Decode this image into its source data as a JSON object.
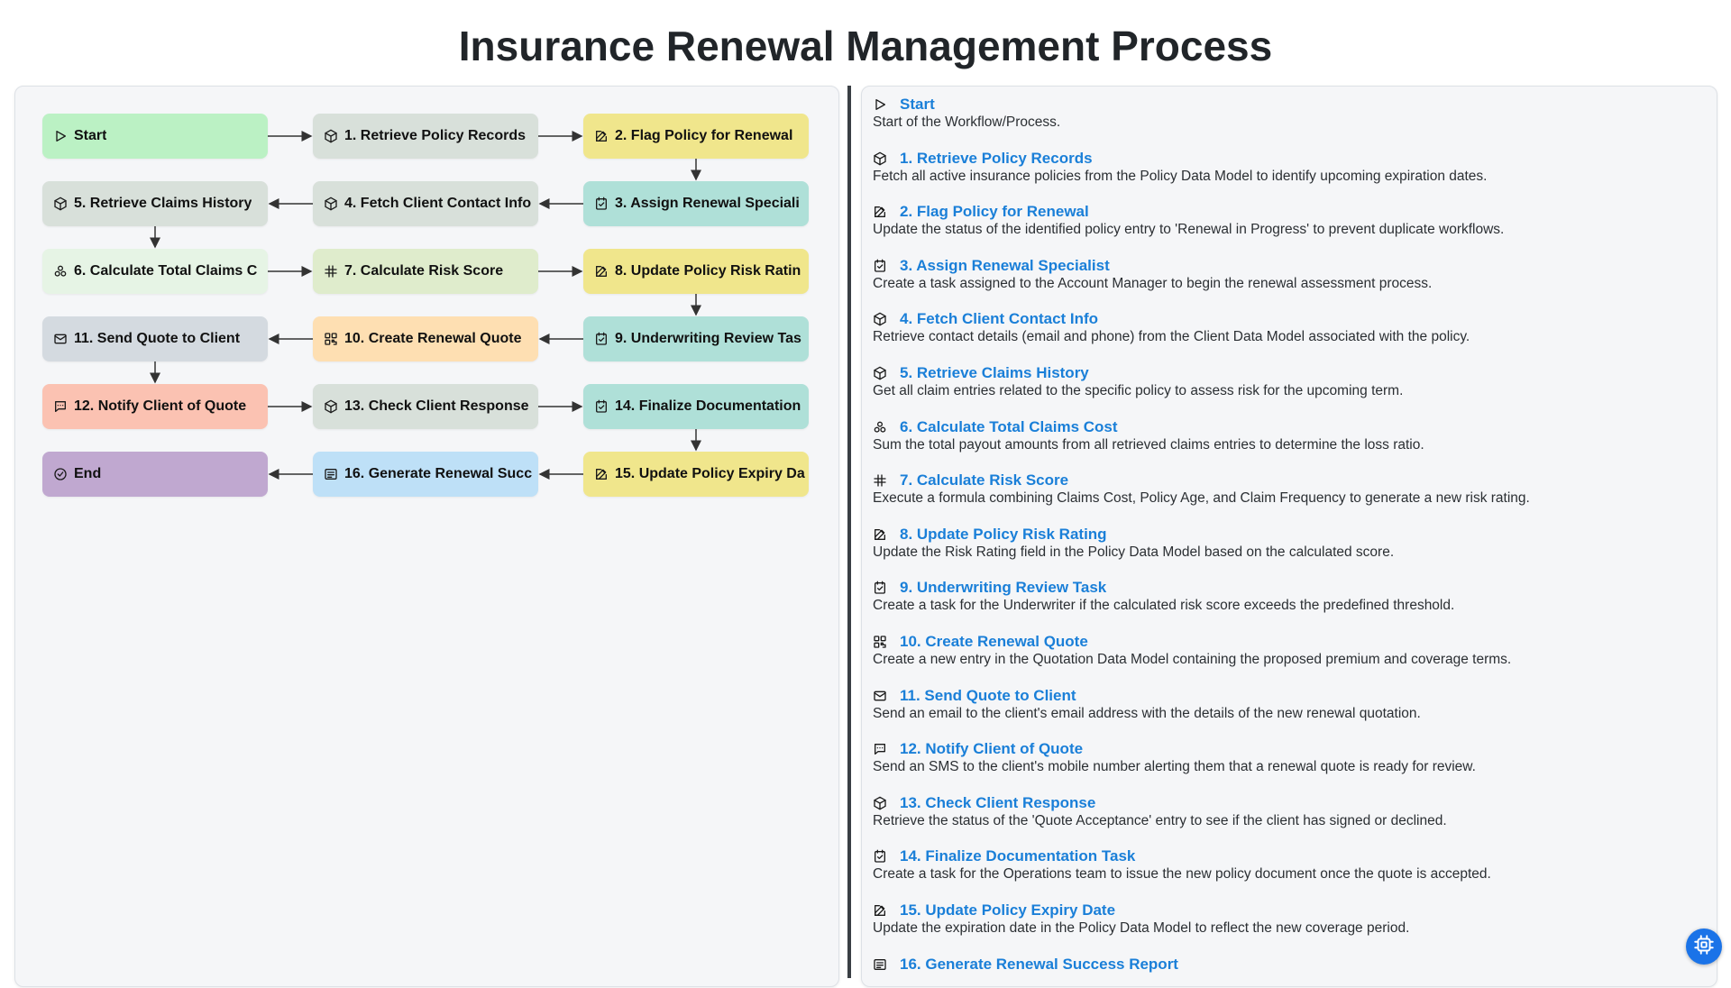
{
  "page": {
    "title": "Insurance Renewal Management Process"
  },
  "colors": {
    "start": "#bbf1c4",
    "records": "#d8e0da",
    "flag": "#f0e68c",
    "assign": "#afe0d8",
    "claims_history": "#d8e0da",
    "contact": "#d8e0da",
    "total_cost": "#e6f4e5",
    "risk": "#dfeccc",
    "update_rating": "#f0e68c",
    "send_quote": "#d4dae0",
    "renewal_quote": "#fedfb2",
    "underwriting": "#afe0d8",
    "notify": "#fbc2b2",
    "response": "#d8e0da",
    "finalize": "#afe0d8",
    "end": "#c0a8d0",
    "report": "#bee0f7",
    "expiry": "#f0e68c",
    "link": "#1a7fd8"
  },
  "flow": {
    "nodes": [
      {
        "id": "start",
        "label": "Start",
        "icon": "play-icon",
        "color": "#bbf1c4"
      },
      {
        "id": "n1",
        "label": "1. Retrieve Policy Records",
        "icon": "cube-icon",
        "color": "#d8e0da"
      },
      {
        "id": "n2",
        "label": "2. Flag Policy for Renewal",
        "icon": "edit-icon",
        "color": "#f0e68c"
      },
      {
        "id": "n3",
        "label": "3. Assign Renewal Speciali",
        "icon": "task-icon",
        "color": "#afe0d8"
      },
      {
        "id": "n4",
        "label": "4. Fetch Client Contact Info",
        "icon": "cube-icon",
        "color": "#d8e0da"
      },
      {
        "id": "n5",
        "label": "5. Retrieve Claims History",
        "icon": "cube-icon",
        "color": "#d8e0da"
      },
      {
        "id": "n6",
        "label": "6. Calculate Total Claims C",
        "icon": "aggregate-icon",
        "color": "#e6f4e5"
      },
      {
        "id": "n7",
        "label": "7. Calculate Risk Score",
        "icon": "formula-icon",
        "color": "#dfeccc"
      },
      {
        "id": "n8",
        "label": "8. Update Policy Risk Ratin",
        "icon": "edit-icon",
        "color": "#f0e68c"
      },
      {
        "id": "n9",
        "label": "9. Underwriting Review Tas",
        "icon": "task-icon",
        "color": "#afe0d8"
      },
      {
        "id": "n10",
        "label": "10. Create Renewal Quote",
        "icon": "grid-icon",
        "color": "#fedfb2"
      },
      {
        "id": "n11",
        "label": "11. Send Quote to Client",
        "icon": "mail-icon",
        "color": "#d4dae0"
      },
      {
        "id": "n12",
        "label": "12. Notify Client of Quote",
        "icon": "message-icon",
        "color": "#fbc2b2"
      },
      {
        "id": "n13",
        "label": "13. Check Client Response",
        "icon": "cube-icon",
        "color": "#d8e0da"
      },
      {
        "id": "n14",
        "label": "14. Finalize Documentation",
        "icon": "task-icon",
        "color": "#afe0d8"
      },
      {
        "id": "n15",
        "label": "15. Update Policy Expiry Da",
        "icon": "edit-icon",
        "color": "#f0e68c"
      },
      {
        "id": "n16",
        "label": "16. Generate Renewal Succ",
        "icon": "report-icon",
        "color": "#bee0f7"
      },
      {
        "id": "end",
        "label": "End",
        "icon": "check-circle-icon",
        "color": "#c0a8d0"
      }
    ]
  },
  "steps": [
    {
      "title": "Start",
      "icon": "play-icon",
      "desc": "Start of the Workflow/Process."
    },
    {
      "title": "1. Retrieve Policy Records",
      "icon": "cube-icon",
      "desc": "Fetch all active insurance policies from the Policy Data Model to identify upcoming expiration dates."
    },
    {
      "title": "2. Flag Policy for Renewal",
      "icon": "edit-icon",
      "desc": "Update the status of the identified policy entry to 'Renewal in Progress' to prevent duplicate workflows."
    },
    {
      "title": "3. Assign Renewal Specialist",
      "icon": "task-icon",
      "desc": "Create a task assigned to the Account Manager to begin the renewal assessment process."
    },
    {
      "title": "4. Fetch Client Contact Info",
      "icon": "cube-icon",
      "desc": "Retrieve contact details (email and phone) from the Client Data Model associated with the policy."
    },
    {
      "title": "5. Retrieve Claims History",
      "icon": "cube-icon",
      "desc": "Get all claim entries related to the specific policy to assess risk for the upcoming term."
    },
    {
      "title": "6. Calculate Total Claims Cost",
      "icon": "aggregate-icon",
      "desc": "Sum the total payout amounts from all retrieved claims entries to determine the loss ratio."
    },
    {
      "title": "7. Calculate Risk Score",
      "icon": "formula-icon",
      "desc": "Execute a formula combining Claims Cost, Policy Age, and Claim Frequency to generate a new risk rating."
    },
    {
      "title": "8. Update Policy Risk Rating",
      "icon": "edit-icon",
      "desc": "Update the Risk Rating field in the Policy Data Model based on the calculated score."
    },
    {
      "title": "9. Underwriting Review Task",
      "icon": "task-icon",
      "desc": "Create a task for the Underwriter if the calculated risk score exceeds the predefined threshold."
    },
    {
      "title": "10. Create Renewal Quote",
      "icon": "grid-icon",
      "desc": "Create a new entry in the Quotation Data Model containing the proposed premium and coverage terms."
    },
    {
      "title": "11. Send Quote to Client",
      "icon": "mail-icon",
      "desc": "Send an email to the client's email address with the details of the new renewal quotation."
    },
    {
      "title": "12. Notify Client of Quote",
      "icon": "message-icon",
      "desc": "Send an SMS to the client's mobile number alerting them that a renewal quote is ready for review."
    },
    {
      "title": "13. Check Client Response",
      "icon": "cube-icon",
      "desc": "Retrieve the status of the 'Quote Acceptance' entry to see if the client has signed or declined."
    },
    {
      "title": "14. Finalize Documentation Task",
      "icon": "task-icon",
      "desc": "Create a task for the Operations team to issue the new policy document once the quote is accepted."
    },
    {
      "title": "15. Update Policy Expiry Date",
      "icon": "edit-icon",
      "desc": "Update the expiration date in the Policy Data Model to reflect the new coverage period."
    },
    {
      "title": "16. Generate Renewal Success Report",
      "icon": "report-icon",
      "desc": ""
    }
  ],
  "help": {
    "icon": "chip-icon"
  }
}
